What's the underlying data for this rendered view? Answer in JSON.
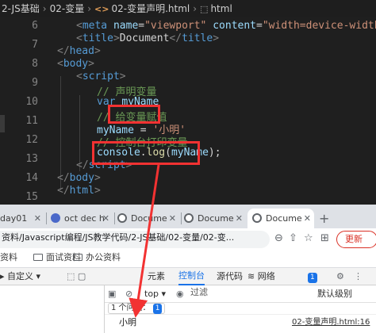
{
  "editor": {
    "breadcrumb": [
      "2-JS基础",
      "02-变量",
      "02-变量声明.html",
      "html"
    ],
    "breadcrumb_icon": "html-tag-icon",
    "active_line": "16",
    "lines": [
      {
        "n": "6"
      },
      {
        "n": "7"
      },
      {
        "n": "8"
      },
      {
        "n": "9"
      },
      {
        "n": "10"
      },
      {
        "n": "11"
      },
      {
        "n": "12"
      },
      {
        "n": "13"
      },
      {
        "n": "14"
      },
      {
        "n": "15"
      },
      {
        "n": "16"
      },
      {
        "n": "17"
      },
      {
        "n": "18"
      },
      {
        "n": "19"
      }
    ],
    "code": {
      "l6_attr1": "name",
      "l6_val1": "\"viewport\"",
      "l6_attr2": "content",
      "l6_val2": "\"width=device-width, initial-",
      "l7_tag": "title",
      "l7_text": "Document",
      "l8_tag": "head",
      "l9_tag": "body",
      "l10_tag": "script",
      "l11_comment": "// 声明变量",
      "l12_kw": "var",
      "l12_name": "myName",
      "l13_comment": "// 给变量赋值",
      "l14_name": "myName",
      "l14_op": " = ",
      "l14_str": "'小明'",
      "l15_comment": "// 控制台打印变量",
      "l16_obj": "console",
      "l16_fn": "log",
      "l16_arg": "myName",
      "l17_tag": "script",
      "l18_tag": "body",
      "l19_tag": "html"
    }
  },
  "browser": {
    "tabs": [
      {
        "label": "day01"
      },
      {
        "label": "oct dec h"
      },
      {
        "label": "Docume"
      },
      {
        "label": "Docume"
      },
      {
        "label": "Docume"
      }
    ],
    "new_tab": "+",
    "address": "资料/Javascript编程/JS教学代码/2-JS基础/02-变量/02-变...",
    "refresh_label": "更新",
    "bookmarks": [
      {
        "label": "资料"
      },
      {
        "label": "面试资料"
      },
      {
        "label": "办公资料"
      }
    ]
  },
  "devtools": {
    "device_label": "自定义",
    "tabs": [
      "元素",
      "控制台",
      "源代码",
      "网络"
    ],
    "active_tab": "控制台",
    "context": "top",
    "filter_placeholder": "过滤",
    "levels": "默认级别",
    "issues_label": "1 个问题：",
    "issues_count": "1",
    "badge_count": "1",
    "console_output": "小明",
    "console_source": "02-变量声明.html:16"
  },
  "colors": {
    "highlight_red": "#f23232",
    "devtools_accent": "#1a73e8"
  }
}
